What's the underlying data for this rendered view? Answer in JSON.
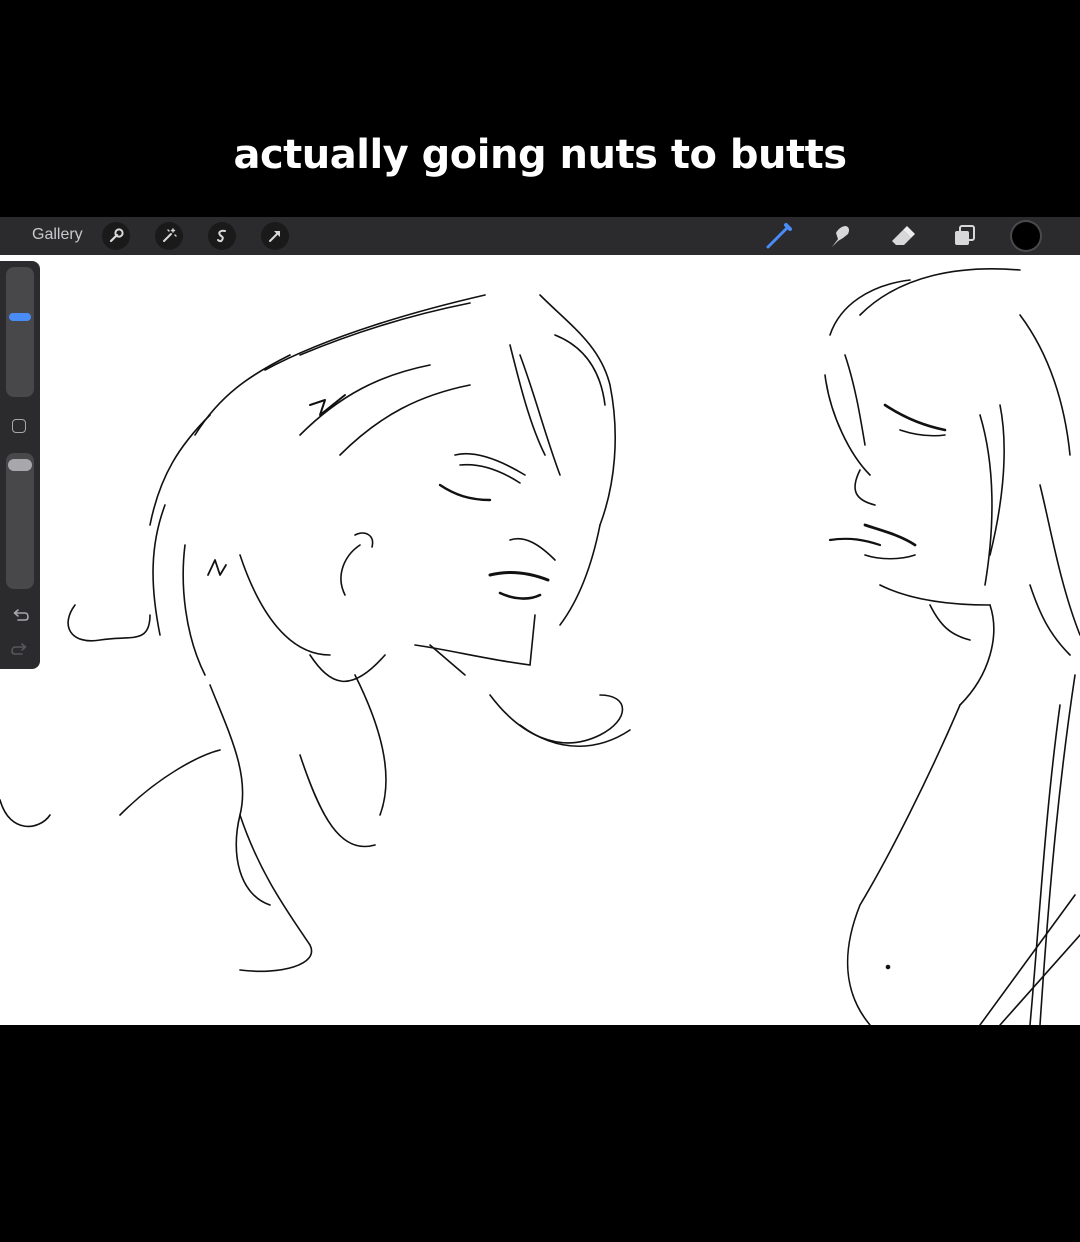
{
  "caption": "actually going nuts to butts",
  "toolbar": {
    "gallery_label": "Gallery",
    "left_tools": [
      "wrench-icon",
      "magic-wand-icon",
      "selection-icon",
      "transform-arrow-icon"
    ],
    "right_tools": [
      "brush-icon",
      "smudge-icon",
      "eraser-icon",
      "layers-icon"
    ],
    "current_color": "#000000",
    "brush_accent": "#4a8cf7"
  },
  "sidebar": {
    "controls": [
      "brush-size-slider",
      "modify-button",
      "opacity-slider",
      "undo-icon",
      "redo-icon"
    ]
  },
  "colors": {
    "toolbar_bg": "#2b2b2d",
    "canvas_bg": "#ffffff",
    "frame_bg": "#000000"
  }
}
